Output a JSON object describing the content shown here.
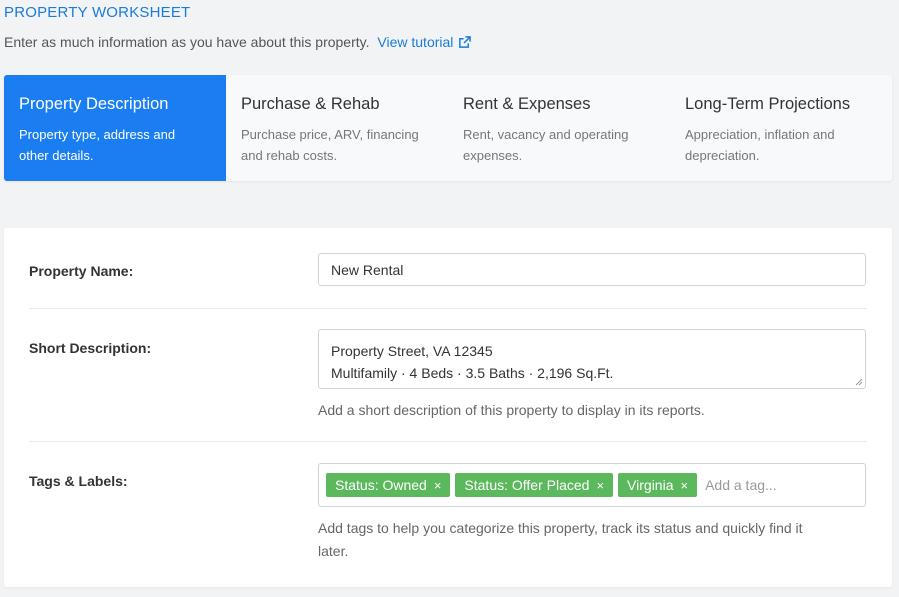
{
  "header": {
    "title": "PROPERTY WORKSHEET",
    "subtitle": "Enter as much information as you have about this property.",
    "tutorial_link": "View tutorial"
  },
  "steps": [
    {
      "title": "Property Description",
      "desc_line1": "Property type, address and",
      "desc_line2": "other details.",
      "active": true
    },
    {
      "title": "Purchase & Rehab",
      "desc_line1": "Purchase price, ARV, financing",
      "desc_line2": "and rehab costs.",
      "active": false
    },
    {
      "title": "Rent & Expenses",
      "desc_line1": "Rent, vacancy and operating",
      "desc_line2": "expenses.",
      "active": false
    },
    {
      "title": "Long-Term Projections",
      "desc_line1": "Appreciation, inflation and",
      "desc_line2": "depreciation.",
      "active": false
    }
  ],
  "form": {
    "property_name": {
      "label": "Property Name:",
      "value": "New Rental"
    },
    "short_description": {
      "label": "Short Description:",
      "line1": "Property Street, VA 12345",
      "line2": "Multifamily · 4 Beds · 3.5 Baths · 2,196 Sq.Ft.",
      "help": "Add a short description of this property to display in its reports."
    },
    "tags": {
      "label": "Tags & Labels:",
      "items": [
        "Status: Owned",
        "Status: Offer Placed",
        "Virginia"
      ],
      "remove_glyph": "×",
      "placeholder": "Add a tag...",
      "help_line1": "Add tags to help you categorize this property, track its status and quickly find it",
      "help_line2": "later."
    }
  },
  "colors": {
    "accent": "#1a7ef2",
    "link": "#1a7bd8",
    "tag": "#5cb85c",
    "background": "#f2f3f5"
  },
  "icons": {
    "tutorial": "external-link-icon",
    "tag_remove": "close-icon"
  }
}
